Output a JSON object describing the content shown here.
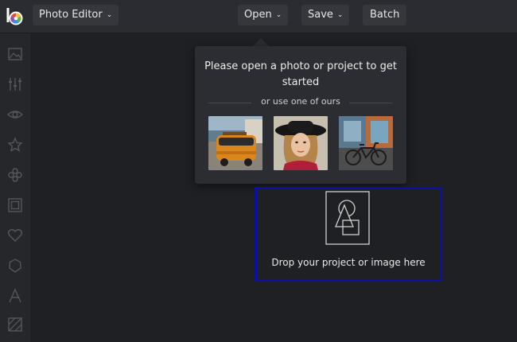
{
  "header": {
    "app_menu_label": "Photo Editor",
    "open_label": "Open",
    "save_label": "Save",
    "batch_label": "Batch"
  },
  "sidebar": {
    "tools": [
      "image-icon",
      "adjust-sliders-icon",
      "eye-icon",
      "star-icon",
      "flower-icon",
      "frame-icon",
      "heart-icon",
      "shape-icon",
      "text-icon",
      "texture-icon"
    ]
  },
  "popover": {
    "title": "Please open a photo or project to get started",
    "subtitle": "or use one of ours",
    "samples": [
      "sample-van",
      "sample-portrait",
      "sample-bicycle"
    ]
  },
  "dropzone": {
    "text": "Drop your project or image here",
    "border_color": "#0b0fa8"
  },
  "colors": {
    "background": "#1f2024",
    "topbar": "#2b2c31",
    "panel": "#2c2d32"
  }
}
